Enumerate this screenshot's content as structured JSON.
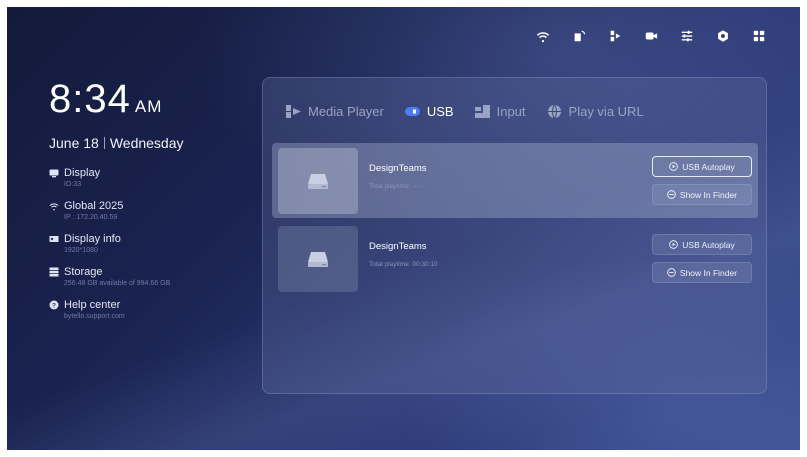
{
  "topbar": {
    "icons": [
      "wifi-icon",
      "screen-cast-icon",
      "media-icon",
      "camera-icon",
      "settings-sliders-icon",
      "gear-icon",
      "apps-grid-icon"
    ]
  },
  "clock": {
    "time": "8:34",
    "ampm": "AM",
    "date": "June 18",
    "weekday": "Wednesday"
  },
  "info": [
    {
      "icon": "display-icon",
      "label": "Display",
      "sub": "IO:33"
    },
    {
      "icon": "wifi-icon",
      "label": "Global 2025",
      "sub": "IP : 172.20.40.59"
    },
    {
      "icon": "display-info-icon",
      "label": "Display info",
      "sub": "1920*1080"
    },
    {
      "icon": "storage-icon",
      "label": "Storage",
      "sub": "256.48 GB available of 994.66 GB"
    },
    {
      "icon": "help-icon",
      "label": "Help center",
      "sub": "bytello.support.com"
    }
  ],
  "tabs": [
    {
      "label": "Media Player",
      "icon": "media-player-icon",
      "active": false
    },
    {
      "label": "USB",
      "icon": "usb-icon",
      "active": true
    },
    {
      "label": "Input",
      "icon": "input-icon",
      "active": false
    },
    {
      "label": "Play via URL",
      "icon": "globe-icon",
      "active": false
    }
  ],
  "drives": [
    {
      "title": "DesignTeams",
      "sub": "Total playtime: --:--",
      "autoplay": "USB Autoplay",
      "finder": "Show In Finder",
      "selected": true
    },
    {
      "title": "DesignTeams",
      "sub": "Total playtime: 00:30:10",
      "autoplay": "USB Autoplay",
      "finder": "Show In Finder",
      "selected": false
    }
  ],
  "colors": {
    "accent": "#4a7cf5",
    "bg_dark": "#131a3a",
    "bg_light": "#3a4d8e"
  }
}
